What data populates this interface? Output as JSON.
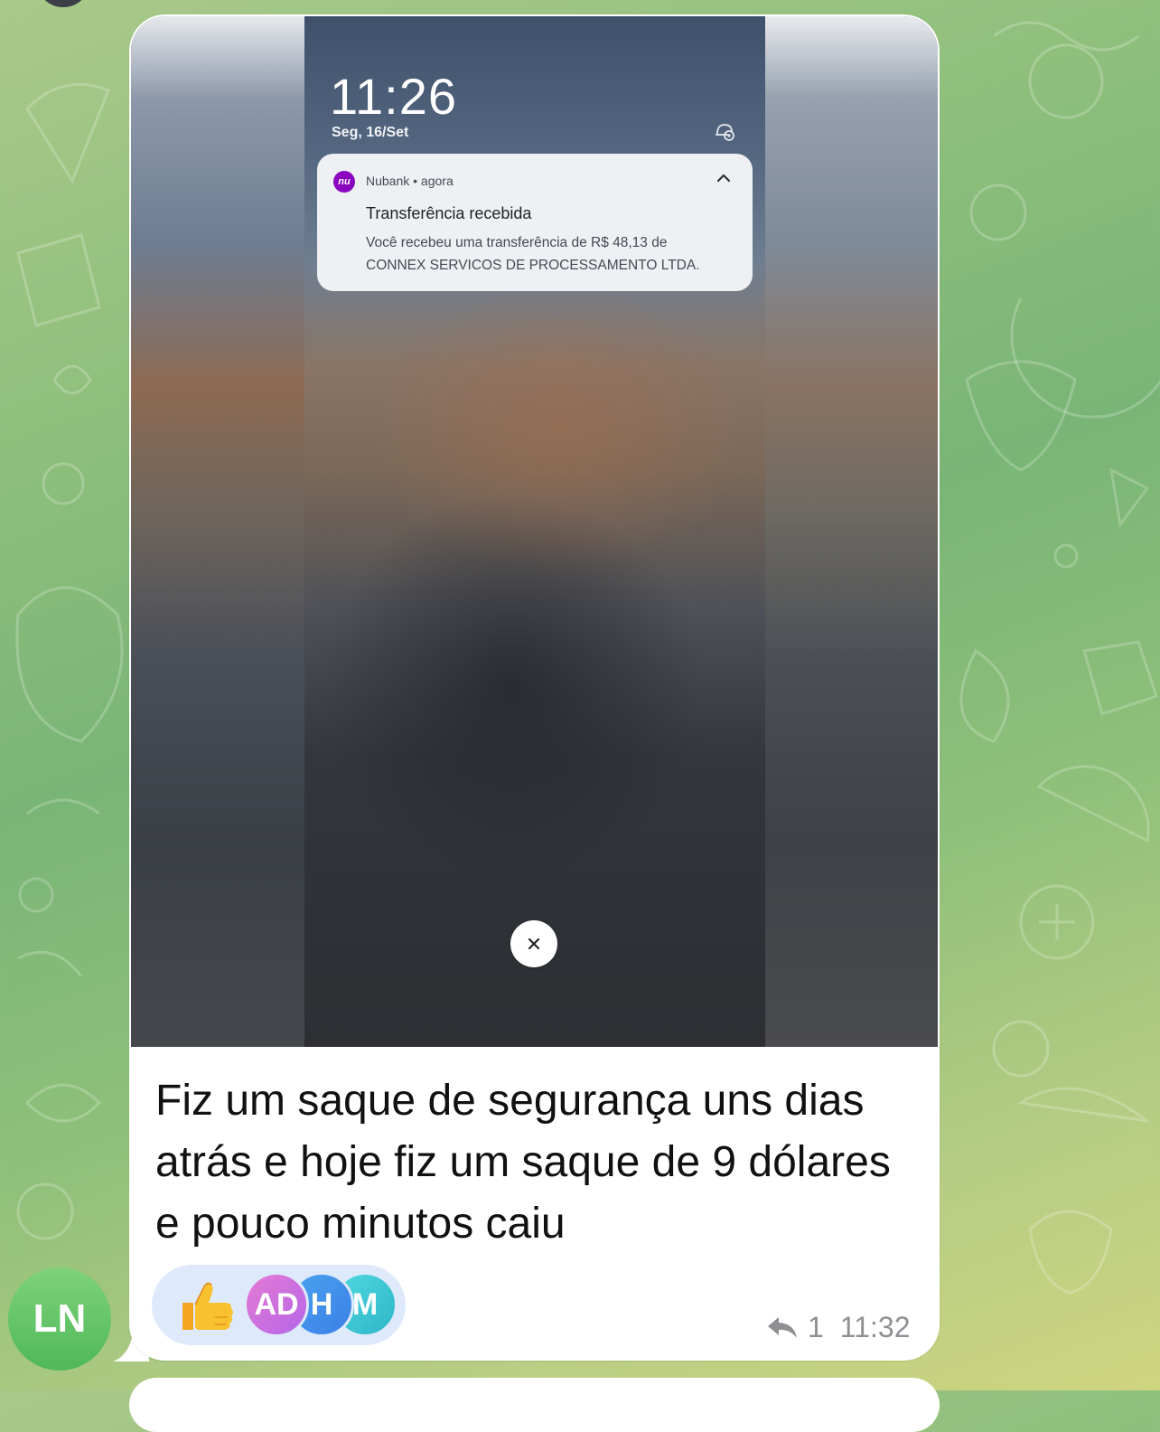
{
  "lockscreen": {
    "time": "11:26",
    "date": "Seg, 16/Set"
  },
  "notification": {
    "app_icon_text": "nu",
    "app_meta": "Nubank • agora",
    "title": "Transferência recebida",
    "body": "Você recebeu uma transferência de R$ 48,13 de CONNEX SERVICOS DE PROCESSAMENTO LTDA.",
    "brand_color": "#8a05be"
  },
  "message": {
    "caption": "Fiz um saque de segurança uns dias atrás e hoje fiz um saque de 9 dólares e pouco minutos caiu",
    "replies_count": "1",
    "time": "11:32"
  },
  "reactions": {
    "emoji": "thumbs-up",
    "avatars": [
      "AD",
      "H",
      "M"
    ]
  },
  "sender": {
    "initials": "LN"
  },
  "icons": {
    "reply": "reply-arrow-icon",
    "close": "close-icon",
    "chevron": "chevron-up-icon",
    "settings": "notification-settings-icon"
  }
}
